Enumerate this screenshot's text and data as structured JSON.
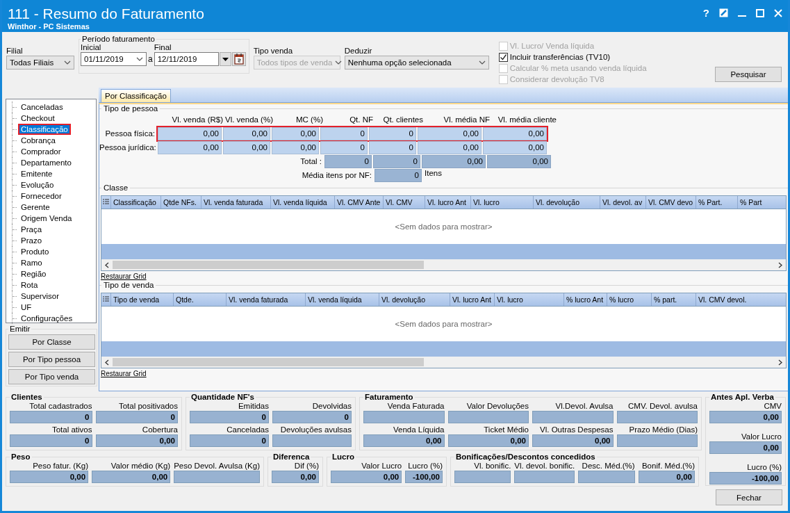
{
  "window": {
    "title": "111 - Resumo do Faturamento",
    "subtitle": "Winthor - PC Sistemas",
    "help_label": "?"
  },
  "filters": {
    "filial": {
      "label": "Filial",
      "value": "Todas Filiais"
    },
    "periodo": {
      "legend": "Período faturamento",
      "inicial": {
        "label": "Inicial",
        "value": "01/11/2019"
      },
      "separator": "a",
      "final": {
        "label": "Final",
        "value": "12/11/2019"
      }
    },
    "tipo_venda": {
      "label": "Tipo venda",
      "value": "Todos tipos de venda",
      "disabled": true
    },
    "deduzir": {
      "label": "Deduzir",
      "value": "Nenhuma opção selecionada",
      "disabled": false
    }
  },
  "options": [
    {
      "label": "Vl. Lucro/ Venda líquida",
      "checked": false,
      "disabled": true
    },
    {
      "label": "Incluir transferências  (TV10)",
      "checked": true,
      "disabled": false
    },
    {
      "label": "Calcular % meta usando venda líquida",
      "checked": false,
      "disabled": true
    },
    {
      "label": "Considerar devolução TV8",
      "checked": false,
      "disabled": true
    }
  ],
  "search_button": "Pesquisar",
  "sidebar": {
    "items": [
      {
        "label": "Canceladas",
        "selected": false,
        "highlighted": false
      },
      {
        "label": "Checkout",
        "selected": false,
        "highlighted": false
      },
      {
        "label": "Classificação",
        "selected": true,
        "highlighted": true
      },
      {
        "label": "Cobrança",
        "selected": false,
        "highlighted": false
      },
      {
        "label": "Comprador",
        "selected": false,
        "highlighted": false
      },
      {
        "label": "Departamento",
        "selected": false,
        "highlighted": false
      },
      {
        "label": "Emitente",
        "selected": false,
        "highlighted": false
      },
      {
        "label": "Evolução",
        "selected": false,
        "highlighted": false
      },
      {
        "label": "Fornecedor",
        "selected": false,
        "highlighted": false
      },
      {
        "label": "Gerente",
        "selected": false,
        "highlighted": false
      },
      {
        "label": "Origem Venda",
        "selected": false,
        "highlighted": false
      },
      {
        "label": "Praça",
        "selected": false,
        "highlighted": false
      },
      {
        "label": "Prazo",
        "selected": false,
        "highlighted": false
      },
      {
        "label": "Produto",
        "selected": false,
        "highlighted": false
      },
      {
        "label": "Ramo",
        "selected": false,
        "highlighted": false
      },
      {
        "label": "Região",
        "selected": false,
        "highlighted": false
      },
      {
        "label": "Rota",
        "selected": false,
        "highlighted": false
      },
      {
        "label": "Supervisor",
        "selected": false,
        "highlighted": false
      },
      {
        "label": "UF",
        "selected": false,
        "highlighted": false
      },
      {
        "label": "Configurações",
        "selected": false,
        "highlighted": false
      }
    ]
  },
  "emitir": {
    "legend": "Emitir",
    "buttons": [
      "Por Classe",
      "Por Tipo pessoa",
      "Por Tipo venda"
    ]
  },
  "tabs": [
    {
      "label": "Por Classificação",
      "selected": true
    }
  ],
  "tipo_pessoa": {
    "legend": "Tipo de pessoa",
    "columns": [
      "Vl. venda (R$)",
      "Vl. venda (%)",
      "MC (%)",
      "Qt. NF",
      "Qt. clientes",
      "Vl. média NF",
      "Vl. média cliente"
    ],
    "rows": [
      {
        "label": "Pessoa física:",
        "values": [
          "0,00",
          "0,00",
          "0,00",
          "0",
          "0",
          "0,00",
          "0,00"
        ],
        "highlighted": true
      },
      {
        "label": "Pessoa jurídica:",
        "values": [
          "0,00",
          "0,00",
          "0,00",
          "0",
          "0",
          "0,00",
          "0,00"
        ],
        "highlighted": false
      }
    ],
    "total": {
      "label": "Total :",
      "values": [
        "0",
        "0",
        "0,00",
        "0,00"
      ]
    },
    "media": {
      "label": "Média itens por NF:",
      "value": "0",
      "unit": "Itens"
    }
  },
  "classe": {
    "legend": "Classe",
    "columns": [
      "Classificação",
      "Qtde NFs.",
      "Vl. venda faturada",
      "Vl. venda líquida",
      "Vl. CMV Ante",
      "Vl. CMV",
      "Vl. lucro Ant",
      "Vl. lucro",
      "Vl. devolução",
      "Vl. devol. av",
      "Vl. CMV devo",
      "% Part.",
      "% Part"
    ],
    "empty_text": "<Sem dados para mostrar>",
    "restore_link": "Restaurar Grid"
  },
  "tipo_venda": {
    "legend": "Tipo de venda",
    "columns": [
      "Tipo de venda",
      "Qtde.",
      "Vl. venda faturada",
      "Vl. venda líquida",
      "Vl. devolução",
      "Vl. lucro Ant",
      "Vl. lucro",
      "% lucro Ant",
      "% lucro",
      "% part.",
      "Vl. CMV devol."
    ],
    "empty_text": "<Sem dados para mostrar>",
    "restore_link": "Restaurar Grid"
  },
  "summary": {
    "clientes": {
      "title": "Clientes",
      "fields": [
        {
          "label": "Total cadastrados",
          "value": "0"
        },
        {
          "label": "Total positivados",
          "value": "0"
        },
        {
          "label": "Total ativos",
          "value": "0"
        },
        {
          "label": "Cobertura",
          "value": "0,00"
        }
      ]
    },
    "quantidade_nfs": {
      "title": "Quantidade NF's",
      "fields": [
        {
          "label": "Emitidas",
          "value": "0"
        },
        {
          "label": "Devolvidas",
          "value": "0"
        },
        {
          "label": "Canceladas",
          "value": "0"
        },
        {
          "label": "Devoluções avulsas"
        }
      ]
    },
    "faturamento": {
      "title": "Faturamento",
      "fields": [
        {
          "label": "Venda Faturada"
        },
        {
          "label": "Valor Devoluções"
        },
        {
          "label": "Vl.Devol. Avulsa"
        },
        {
          "label": "CMV. Devol. avulsa"
        },
        {
          "label": "Venda Líquida",
          "value": "0,00"
        },
        {
          "label": "Ticket Médio",
          "value": "0,00"
        },
        {
          "label": "Vl. Outras Despesas",
          "value": "0,00"
        },
        {
          "label": "Prazo Médio (Dias)"
        }
      ]
    },
    "antes_verba": {
      "title": "Antes Apl. Verba",
      "fields": [
        {
          "label": "CMV",
          "value": "0,00"
        },
        {
          "label": "Valor Lucro",
          "value": "0,00"
        },
        {
          "label": "Lucro (%)",
          "value": "-100,00"
        }
      ]
    },
    "peso": {
      "title": "Peso",
      "fields": [
        {
          "label": "Peso fatur. (Kg)",
          "value": "0,00"
        },
        {
          "label": "Valor médio (Kg)",
          "value": "0,00"
        },
        {
          "label": "Peso Devol. Avulsa (Kg)"
        }
      ]
    },
    "diferenca": {
      "title": "Diferenca",
      "fields": [
        {
          "label": "Dif (%)",
          "value": "0,00"
        }
      ]
    },
    "lucro": {
      "title": "Lucro",
      "fields": [
        {
          "label": "Valor Lucro",
          "value": "0,00"
        },
        {
          "label": "Lucro (%)",
          "value": "-100,00"
        }
      ]
    },
    "bonificacoes": {
      "title": "Bonificações/Descontos concedidos",
      "fields": [
        {
          "label": "Vl. bonific."
        },
        {
          "label": "Vl. devol. bonific."
        },
        {
          "label": "Desc. Méd.(%)"
        },
        {
          "label": "Bonif. Méd.(%)",
          "value": "0,00"
        }
      ]
    }
  },
  "close_button": "Fechar"
}
